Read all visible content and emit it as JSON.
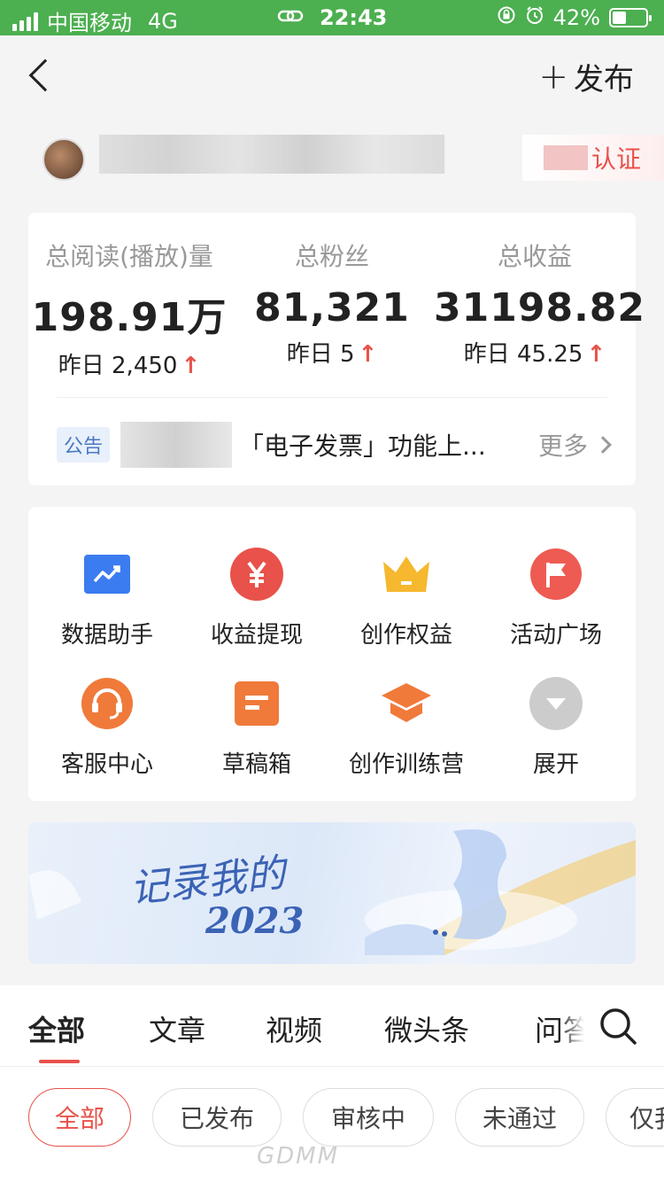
{
  "status_bar": {
    "carrier": "中国移动",
    "network": "4G",
    "time": "22:43",
    "battery": "42%",
    "battery_level": 0.42
  },
  "nav": {
    "publish_label": "发布"
  },
  "user": {
    "verify_label": "认证"
  },
  "stats": [
    {
      "label": "总阅读(播放)量",
      "value": "198.91万",
      "yesterday": "昨日 2,450"
    },
    {
      "label": "总粉丝",
      "value": "81,321",
      "yesterday": "昨日 5"
    },
    {
      "label": "总收益",
      "value": "31198.82",
      "yesterday": "昨日 45.25"
    }
  ],
  "notice": {
    "tag": "公告",
    "text": "「电子发票」功能上...",
    "more": "更多"
  },
  "tools": [
    {
      "label": "数据助手",
      "icon": "chart-icon",
      "color": "#3b7cf0"
    },
    {
      "label": "收益提现",
      "icon": "yuan-icon",
      "color": "#e8524a"
    },
    {
      "label": "创作权益",
      "icon": "crown-icon",
      "color": "#f5b82e"
    },
    {
      "label": "活动广场",
      "icon": "flag-icon",
      "color": "#ee5b52"
    },
    {
      "label": "客服中心",
      "icon": "headset-icon",
      "color": "#f07a3a"
    },
    {
      "label": "草稿箱",
      "icon": "draft-icon",
      "color": "#f07a3a"
    },
    {
      "label": "创作训练营",
      "icon": "graduation-cap-icon",
      "color": "#f07a3a"
    },
    {
      "label": "展开",
      "icon": "expand-down-icon",
      "color": "#cccccc"
    }
  ],
  "banner": {
    "line1": "记录我的",
    "line2": "2023"
  },
  "tabs": [
    "全部",
    "文章",
    "视频",
    "微头条",
    "问答"
  ],
  "filters": [
    "全部",
    "已发布",
    "审核中",
    "未通过",
    "仅我可见"
  ],
  "watermark": "GDMM"
}
